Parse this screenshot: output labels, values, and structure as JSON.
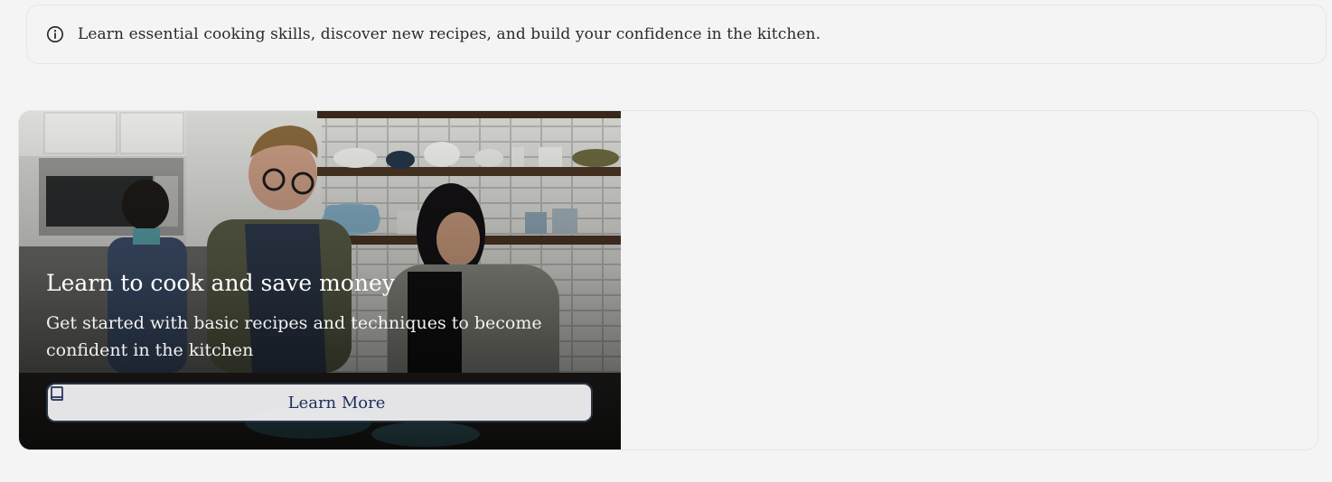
{
  "banner": {
    "icon": "info-icon",
    "text": "Learn essential cooking skills, discover new recipes, and build your confidence in the kitchen."
  },
  "hero_card": {
    "title": "Learn to cook and save money",
    "subtitle": "Get started with basic recipes and techniques to become confident in the kitchen",
    "button": {
      "icon": "book-icon",
      "label": "Learn More"
    }
  },
  "colors": {
    "page_background": "#f4f4f4",
    "button_text": "#1f2f5a",
    "button_border": "#2b3444"
  }
}
